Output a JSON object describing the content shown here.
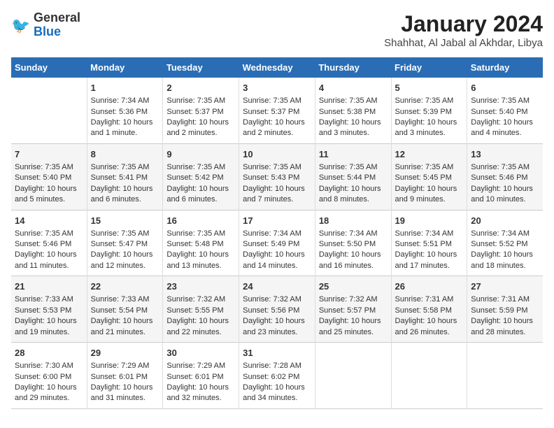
{
  "header": {
    "logo_general": "General",
    "logo_blue": "Blue",
    "title": "January 2024",
    "subtitle": "Shahhat, Al Jabal al Akhdar, Libya"
  },
  "columns": [
    "Sunday",
    "Monday",
    "Tuesday",
    "Wednesday",
    "Thursday",
    "Friday",
    "Saturday"
  ],
  "weeks": [
    [
      {
        "day": "",
        "text": ""
      },
      {
        "day": "1",
        "text": "Sunrise: 7:34 AM\nSunset: 5:36 PM\nDaylight: 10 hours\nand 1 minute."
      },
      {
        "day": "2",
        "text": "Sunrise: 7:35 AM\nSunset: 5:37 PM\nDaylight: 10 hours\nand 2 minutes."
      },
      {
        "day": "3",
        "text": "Sunrise: 7:35 AM\nSunset: 5:37 PM\nDaylight: 10 hours\nand 2 minutes."
      },
      {
        "day": "4",
        "text": "Sunrise: 7:35 AM\nSunset: 5:38 PM\nDaylight: 10 hours\nand 3 minutes."
      },
      {
        "day": "5",
        "text": "Sunrise: 7:35 AM\nSunset: 5:39 PM\nDaylight: 10 hours\nand 3 minutes."
      },
      {
        "day": "6",
        "text": "Sunrise: 7:35 AM\nSunset: 5:40 PM\nDaylight: 10 hours\nand 4 minutes."
      }
    ],
    [
      {
        "day": "7",
        "text": "Sunrise: 7:35 AM\nSunset: 5:40 PM\nDaylight: 10 hours\nand 5 minutes."
      },
      {
        "day": "8",
        "text": "Sunrise: 7:35 AM\nSunset: 5:41 PM\nDaylight: 10 hours\nand 6 minutes."
      },
      {
        "day": "9",
        "text": "Sunrise: 7:35 AM\nSunset: 5:42 PM\nDaylight: 10 hours\nand 6 minutes."
      },
      {
        "day": "10",
        "text": "Sunrise: 7:35 AM\nSunset: 5:43 PM\nDaylight: 10 hours\nand 7 minutes."
      },
      {
        "day": "11",
        "text": "Sunrise: 7:35 AM\nSunset: 5:44 PM\nDaylight: 10 hours\nand 8 minutes."
      },
      {
        "day": "12",
        "text": "Sunrise: 7:35 AM\nSunset: 5:45 PM\nDaylight: 10 hours\nand 9 minutes."
      },
      {
        "day": "13",
        "text": "Sunrise: 7:35 AM\nSunset: 5:46 PM\nDaylight: 10 hours\nand 10 minutes."
      }
    ],
    [
      {
        "day": "14",
        "text": "Sunrise: 7:35 AM\nSunset: 5:46 PM\nDaylight: 10 hours\nand 11 minutes."
      },
      {
        "day": "15",
        "text": "Sunrise: 7:35 AM\nSunset: 5:47 PM\nDaylight: 10 hours\nand 12 minutes."
      },
      {
        "day": "16",
        "text": "Sunrise: 7:35 AM\nSunset: 5:48 PM\nDaylight: 10 hours\nand 13 minutes."
      },
      {
        "day": "17",
        "text": "Sunrise: 7:34 AM\nSunset: 5:49 PM\nDaylight: 10 hours\nand 14 minutes."
      },
      {
        "day": "18",
        "text": "Sunrise: 7:34 AM\nSunset: 5:50 PM\nDaylight: 10 hours\nand 16 minutes."
      },
      {
        "day": "19",
        "text": "Sunrise: 7:34 AM\nSunset: 5:51 PM\nDaylight: 10 hours\nand 17 minutes."
      },
      {
        "day": "20",
        "text": "Sunrise: 7:34 AM\nSunset: 5:52 PM\nDaylight: 10 hours\nand 18 minutes."
      }
    ],
    [
      {
        "day": "21",
        "text": "Sunrise: 7:33 AM\nSunset: 5:53 PM\nDaylight: 10 hours\nand 19 minutes."
      },
      {
        "day": "22",
        "text": "Sunrise: 7:33 AM\nSunset: 5:54 PM\nDaylight: 10 hours\nand 21 minutes."
      },
      {
        "day": "23",
        "text": "Sunrise: 7:32 AM\nSunset: 5:55 PM\nDaylight: 10 hours\nand 22 minutes."
      },
      {
        "day": "24",
        "text": "Sunrise: 7:32 AM\nSunset: 5:56 PM\nDaylight: 10 hours\nand 23 minutes."
      },
      {
        "day": "25",
        "text": "Sunrise: 7:32 AM\nSunset: 5:57 PM\nDaylight: 10 hours\nand 25 minutes."
      },
      {
        "day": "26",
        "text": "Sunrise: 7:31 AM\nSunset: 5:58 PM\nDaylight: 10 hours\nand 26 minutes."
      },
      {
        "day": "27",
        "text": "Sunrise: 7:31 AM\nSunset: 5:59 PM\nDaylight: 10 hours\nand 28 minutes."
      }
    ],
    [
      {
        "day": "28",
        "text": "Sunrise: 7:30 AM\nSunset: 6:00 PM\nDaylight: 10 hours\nand 29 minutes."
      },
      {
        "day": "29",
        "text": "Sunrise: 7:29 AM\nSunset: 6:01 PM\nDaylight: 10 hours\nand 31 minutes."
      },
      {
        "day": "30",
        "text": "Sunrise: 7:29 AM\nSunset: 6:01 PM\nDaylight: 10 hours\nand 32 minutes."
      },
      {
        "day": "31",
        "text": "Sunrise: 7:28 AM\nSunset: 6:02 PM\nDaylight: 10 hours\nand 34 minutes."
      },
      {
        "day": "",
        "text": ""
      },
      {
        "day": "",
        "text": ""
      },
      {
        "day": "",
        "text": ""
      }
    ]
  ]
}
